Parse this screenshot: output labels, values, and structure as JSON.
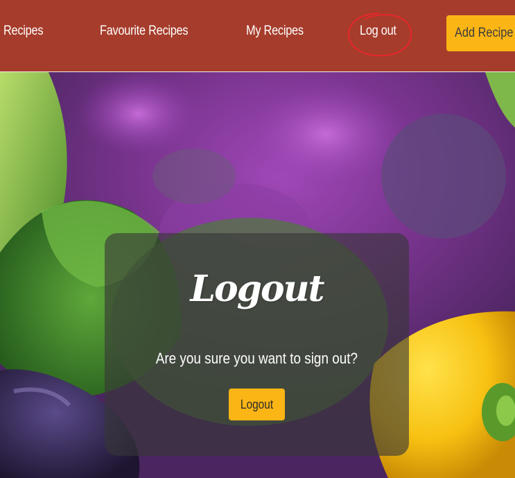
{
  "nav": {
    "links": [
      {
        "label": "Recipes"
      },
      {
        "label": "Favourite Recipes"
      },
      {
        "label": "My Recipes"
      },
      {
        "label": "Log out"
      }
    ],
    "add_recipe_label": "Add Recipe",
    "bar_color": "#a63c2b",
    "annotation_color": "#e8262c"
  },
  "logout": {
    "title": "Logout",
    "question": "Are you sure you want to sign out?",
    "button_label": "Logout",
    "button_color": "#fbb515"
  },
  "background": {
    "image_subject": "vegetables-photo"
  }
}
